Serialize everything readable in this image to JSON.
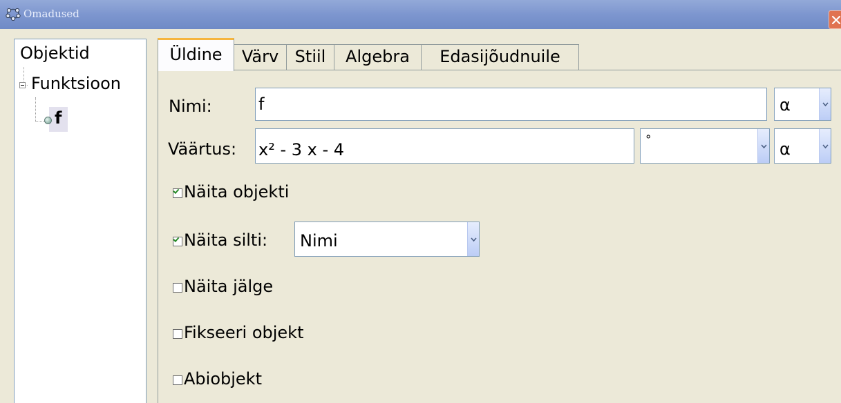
{
  "window": {
    "title": "Omadused",
    "close_glyph": "✕"
  },
  "tree": {
    "root_label": "Objektid",
    "group_label": "Funktsioon",
    "leaf_label": "f"
  },
  "tabs": [
    {
      "label": "Üldine",
      "active": true
    },
    {
      "label": "Värv",
      "active": false
    },
    {
      "label": "Stiil",
      "active": false
    },
    {
      "label": "Algebra",
      "active": false
    },
    {
      "label": "Edasijõudnuile",
      "active": false
    }
  ],
  "general": {
    "name_label": "Nimi:",
    "name_value": "f",
    "name_symbol": "α",
    "value_label": "Väärtus:",
    "value_value": "x² - 3 x - 4",
    "degree_value": "°",
    "value_symbol": "α",
    "show_object_label": "Näita objekti",
    "show_object_checked": true,
    "show_label_label": "Näita silti:",
    "show_label_checked": true,
    "label_mode_value": "Nimi",
    "show_trace_label": "Näita jälge",
    "show_trace_checked": false,
    "fix_object_label": "Fikseeri objekt",
    "fix_object_checked": false,
    "auxiliary_label": "Abiobjekt",
    "auxiliary_checked": false
  },
  "colors": {
    "titlebar": "#7d96cf",
    "active_tab_highlight": "#f6b53e",
    "panel": "#ece9d8"
  }
}
